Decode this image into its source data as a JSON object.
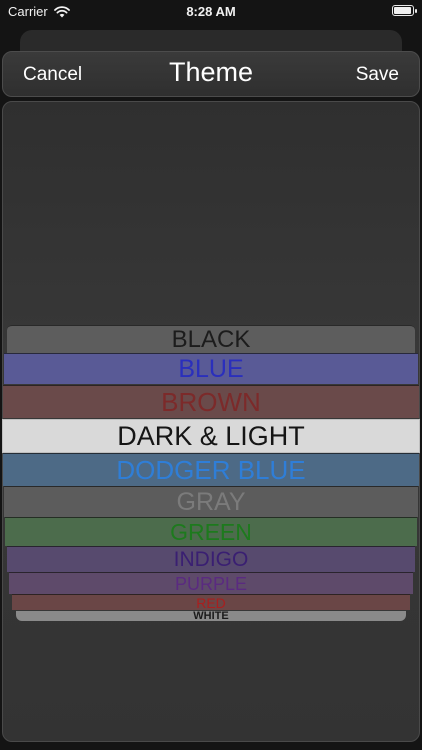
{
  "status_bar": {
    "carrier": "Carrier",
    "time": "8:28 AM"
  },
  "nav": {
    "cancel_label": "Cancel",
    "title": "Theme",
    "save_label": "Save"
  },
  "picker": {
    "items": [
      "BLACK",
      "BLUE",
      "BROWN",
      "DARK & LIGHT",
      "DODGER BLUE",
      "GRAY",
      "GREEN",
      "INDIGO",
      "PURPLE",
      "RED",
      "WHITE"
    ],
    "selected": "DARK & LIGHT"
  },
  "colors": {
    "background": "#141414",
    "selected_row": "#d9d9d9",
    "blue": "#2a2fbc",
    "brown": "#7c2a2a",
    "dodger_blue": "#2f7ed7",
    "green": "#1d7a1d",
    "indigo": "#3a1f72",
    "purple": "#5a2a80",
    "red": "#a81f1f"
  }
}
